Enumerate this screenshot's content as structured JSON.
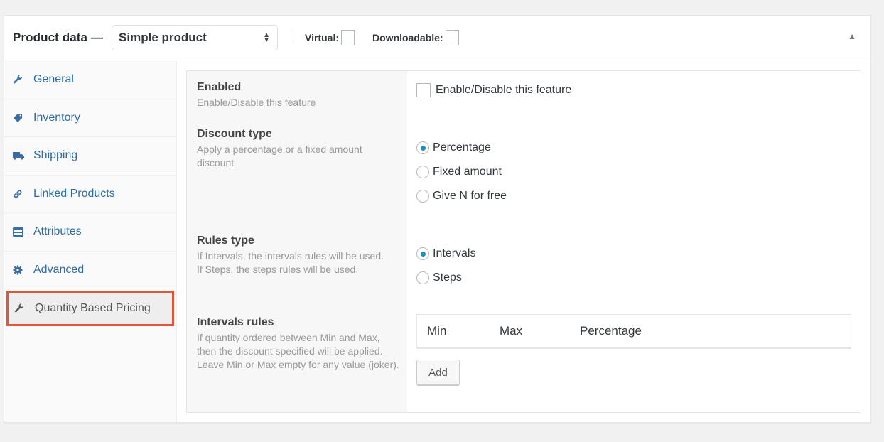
{
  "header": {
    "title": "Product data —",
    "product_type": "Simple product",
    "virtual_label": "Virtual:",
    "virtual_checked": false,
    "downloadable_label": "Downloadable:",
    "downloadable_checked": false,
    "collapse_icon": "▲"
  },
  "sidebar": {
    "items": [
      {
        "label": "General",
        "icon": "wrench-icon",
        "glyph": "🔧"
      },
      {
        "label": "Inventory",
        "icon": "tag-icon",
        "glyph": "◆"
      },
      {
        "label": "Shipping",
        "icon": "truck-icon",
        "glyph": "■"
      },
      {
        "label": "Linked Products",
        "icon": "link-icon",
        "glyph": "∞"
      },
      {
        "label": "Attributes",
        "icon": "list-icon",
        "glyph": "▤"
      },
      {
        "label": "Advanced",
        "icon": "gear-icon",
        "glyph": "✱"
      },
      {
        "label": "Quantity Based Pricing",
        "icon": "wrench-icon",
        "glyph": "🔧",
        "active": true
      }
    ]
  },
  "fields": {
    "enabled": {
      "title": "Enabled",
      "description": "Enable/Disable this feature",
      "checkbox_label": "Enable/Disable this feature",
      "checked": false
    },
    "discount_type": {
      "title": "Discount type",
      "description": "Apply a percentage or a fixed amount discount",
      "options": [
        "Percentage",
        "Fixed amount",
        "Give N for free"
      ],
      "selected": "Percentage"
    },
    "rules_type": {
      "title": "Rules type",
      "description_1": "If Intervals, the intervals rules will be used.",
      "description_2": "If Steps, the steps rules will be used.",
      "options": [
        "Intervals",
        "Steps"
      ],
      "selected": "Intervals"
    },
    "intervals_rules": {
      "title": "Intervals rules",
      "description_1": "If quantity ordered between Min and Max, then the discount specified will be applied.",
      "description_2": "Leave Min or Max empty for any value (joker).",
      "columns": [
        "Min",
        "Max",
        "Percentage"
      ],
      "add_label": "Add"
    }
  }
}
